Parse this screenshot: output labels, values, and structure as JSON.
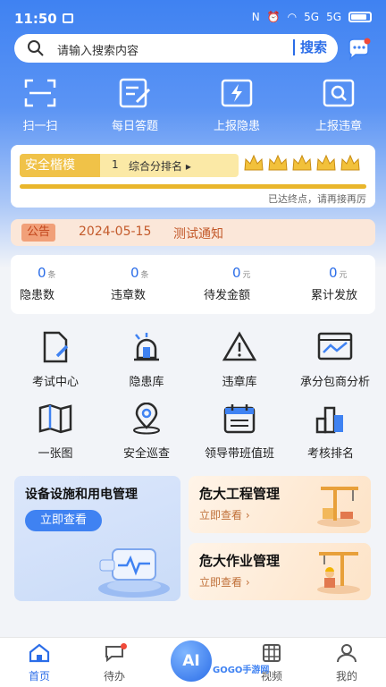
{
  "status": {
    "time": "11:50",
    "signal": "5G",
    "signal2": "5G"
  },
  "search": {
    "placeholder": "请输入搜索内容",
    "button": "搜索"
  },
  "quick_actions": [
    {
      "label": "扫一扫",
      "icon": "scan-icon"
    },
    {
      "label": "每日答题",
      "icon": "quiz-icon"
    },
    {
      "label": "上报隐患",
      "icon": "report-hazard-icon"
    },
    {
      "label": "上报违章",
      "icon": "report-violation-icon"
    }
  ],
  "ranking": {
    "tag": "安全楷模",
    "rank": "1",
    "summary": "综合分排名",
    "stars": 5,
    "progress_percent": 100,
    "note": "已达终点，请再接再厉"
  },
  "notice": {
    "badge": "公告",
    "date": "2024-05-15",
    "title": "测试通知"
  },
  "stats": [
    {
      "value": "0",
      "unit": "条",
      "label": "隐患数"
    },
    {
      "value": "0",
      "unit": "条",
      "label": "违章数"
    },
    {
      "value": "0",
      "unit": "元",
      "label": "待发金额"
    },
    {
      "value": "0",
      "unit": "元",
      "label": "累计发放"
    }
  ],
  "features": [
    {
      "label": "考试中心",
      "icon": "exam-icon"
    },
    {
      "label": "隐患库",
      "icon": "alarm-light-icon"
    },
    {
      "label": "违章库",
      "icon": "warning-icon"
    },
    {
      "label": "承分包商分析",
      "icon": "analysis-icon"
    },
    {
      "label": "一张图",
      "icon": "map-icon"
    },
    {
      "label": "安全巡查",
      "icon": "location-icon"
    },
    {
      "label": "领导带班值班",
      "icon": "calendar-icon"
    },
    {
      "label": "考核排名",
      "icon": "ranking-icon"
    }
  ],
  "cards": {
    "equipment": {
      "title": "设备设施和用电管理",
      "button": "立即查看"
    },
    "major_project": {
      "title": "危大工程管理",
      "link": "立即查看"
    },
    "major_work": {
      "title": "危大作业管理",
      "link": "立即查看"
    }
  },
  "tabs": [
    {
      "label": "首页",
      "active": true
    },
    {
      "label": "待办",
      "active": false
    },
    {
      "label": "AI",
      "active": false
    },
    {
      "label": "视频",
      "active": false
    },
    {
      "label": "我的",
      "active": false
    }
  ],
  "watermark": "GOGO手游网",
  "colors": {
    "primary": "#3f82f2",
    "gold": "#f0c248",
    "notice": "#c35a2b"
  }
}
